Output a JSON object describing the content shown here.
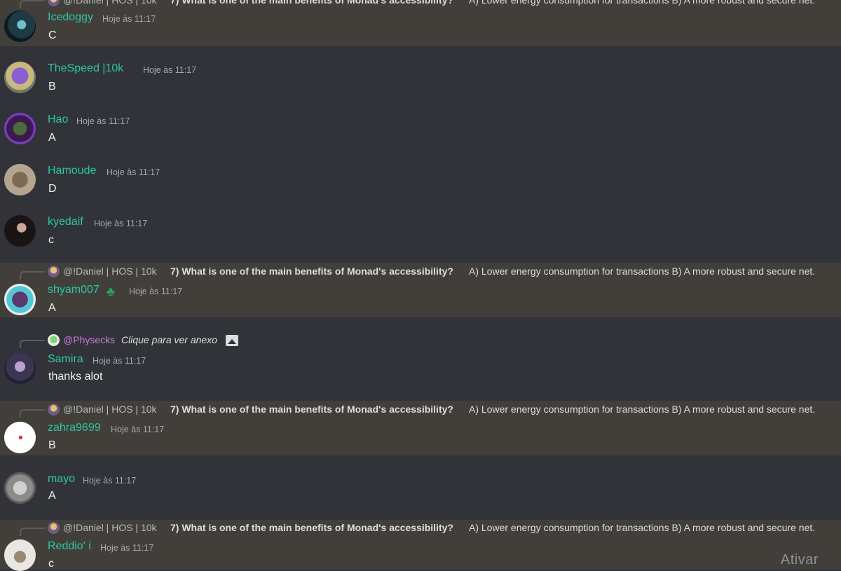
{
  "messages": [
    {
      "username": "Icedoggy",
      "time": "Hoje às 11:17",
      "text": "C",
      "reply": {
        "author": "@!Daniel | HOS | 10k",
        "question": "7) What is one of the main benefits of Monad's accessibility?",
        "tail": "A) Lower energy consumption for transactions B) A more robust and secure net."
      }
    },
    {
      "username": "TheSpeed |10k",
      "time": "Hoje às 11:17",
      "text": "B"
    },
    {
      "username": "Hao",
      "time": "Hoje às 11:17",
      "text": "A"
    },
    {
      "username": "Hamoude",
      "time": "Hoje às 11:17",
      "text": "D"
    },
    {
      "username": "kyedaif",
      "time": "Hoje às 11:17",
      "text": "c"
    },
    {
      "username": "shyam007",
      "time": "Hoje às 11:17",
      "text": "A",
      "reply": {
        "author": "@!Daniel | HOS | 10k",
        "question": "7) What is one of the main benefits of Monad's accessibility?",
        "tail": "A) Lower energy consumption for transactions B) A more robust and secure net."
      }
    },
    {
      "username": "Samira",
      "time": "Hoje às 11:17",
      "text": "thanks alot",
      "reply": {
        "author": "@Physecks",
        "question": "Clique para ver anexo"
      }
    },
    {
      "username": "zahra9699",
      "time": "Hoje às 11:17",
      "text": "B",
      "reply": {
        "author": "@!Daniel | HOS | 10k",
        "question": "7) What is one of the main benefits of Monad's accessibility?",
        "tail": "A) Lower energy consumption for transactions B) A more robust and secure net."
      }
    },
    {
      "username": "mayo",
      "time": "Hoje às 11:17",
      "text": "A"
    },
    {
      "username": "Reddio' i",
      "time": "Hoje às 11:17",
      "text": "c",
      "reply": {
        "author": "@!Daniel | HOS | 10k",
        "question": "7) What is one of the main benefits of Monad's accessibility?",
        "tail": "A) Lower energy consumption for transactions B) A more robust and secure net."
      }
    }
  ],
  "watermark": "Ativar",
  "colors": {
    "background": "#313338",
    "highlight": "#423f3a",
    "username": "#2dc7a2",
    "mention_pink": "#c77dd8"
  }
}
